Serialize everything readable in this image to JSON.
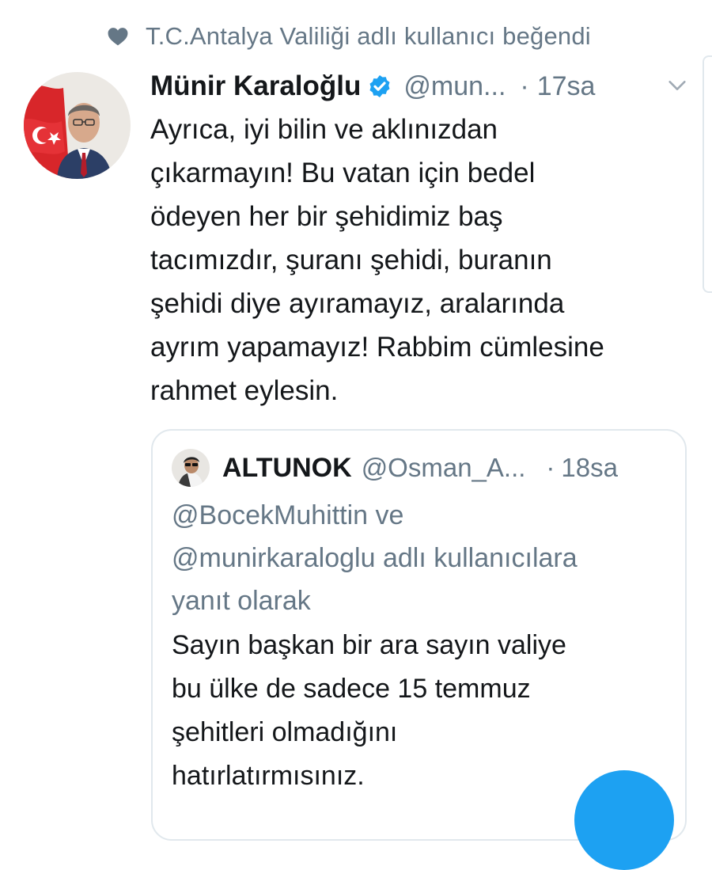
{
  "social_context": {
    "text": "T.C.Antalya Valiliği adlı kullanıcı beğendi",
    "icon": "heart-icon"
  },
  "tweet": {
    "author_name": "Münir Karaloğlu",
    "verified": true,
    "handle": "@mun...",
    "dot": "·",
    "time": "17sa",
    "text": "Ayrıca, iyi bilin ve aklınızdan\nçıkarmayın! Bu vatan için bedel\nödeyen her bir şehidimiz baş\ntacımızdır, şuranı şehidi, buranın\nşehidi diye ayıramayız, aralarında\nayrım yapamayız! Rabbim cümlesine\nrahmet eylesin."
  },
  "quoted_tweet": {
    "author_name": "ALTUNOK",
    "handle": "@Osman_A...",
    "dot": "·",
    "time": "18sa",
    "reply_context": "@BocekMuhittin ve\n@munirkaraloglu adlı kullanıcılara\nyanıt olarak",
    "text": "Sayın başkan bir ara sayın valiye\nbu ülke de sadece 15 temmuz\nşehitleri olmadığını\nhatırlatırmısınız."
  },
  "colors": {
    "primary_text": "#14171a",
    "secondary_text": "#657786",
    "verified_blue": "#1da1f2",
    "border": "#e1e8ed",
    "fab": "#1da1f2"
  }
}
